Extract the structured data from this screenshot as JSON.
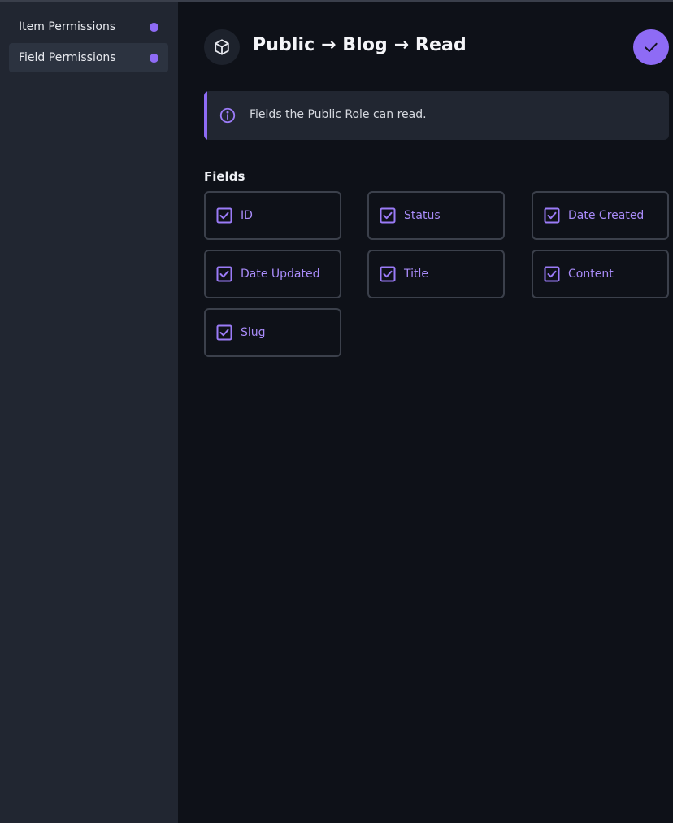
{
  "sidebar": {
    "items": [
      {
        "label": "Item Permissions",
        "active": false
      },
      {
        "label": "Field Permissions",
        "active": true
      }
    ]
  },
  "header": {
    "title": "Public → Blog → Read",
    "icon": "box-icon",
    "save_icon": "check-icon"
  },
  "notice": {
    "text": "Fields the Public Role can read.",
    "icon": "info-icon"
  },
  "fields": {
    "label": "Fields",
    "items": [
      {
        "label": "ID",
        "checked": true
      },
      {
        "label": "Status",
        "checked": true
      },
      {
        "label": "Date Created",
        "checked": true
      },
      {
        "label": "Date Updated",
        "checked": true
      },
      {
        "label": "Title",
        "checked": true
      },
      {
        "label": "Content",
        "checked": true
      },
      {
        "label": "Slug",
        "checked": true
      }
    ]
  },
  "colors": {
    "accent": "#8e6bf5",
    "background": "#0e1118",
    "sidebar": "#212631"
  }
}
